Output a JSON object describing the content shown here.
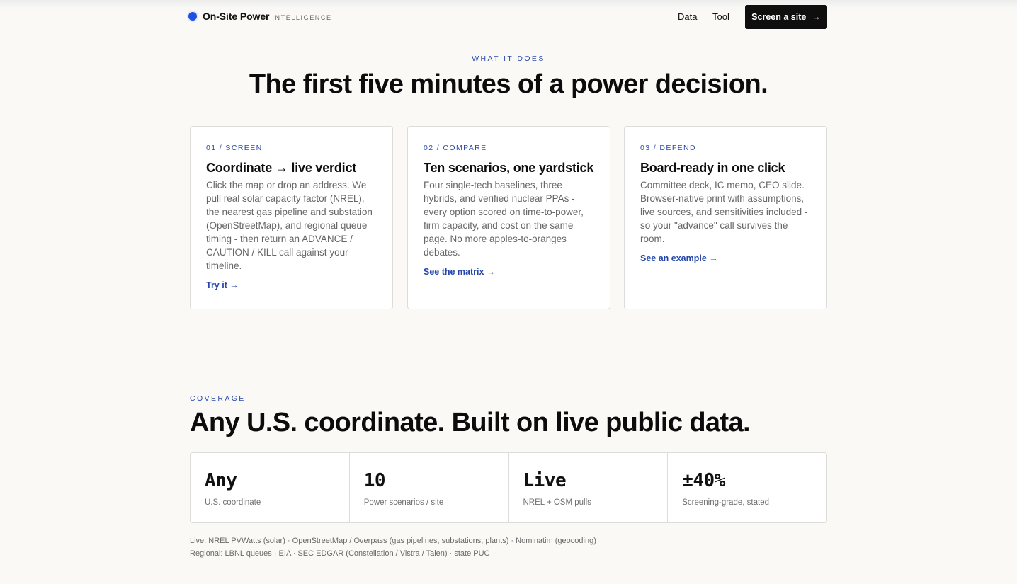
{
  "nav": {
    "brand_name": "On-Site Power",
    "brand_tag": "INTELLIGENCE",
    "links": [
      "Data",
      "Tool"
    ],
    "cta_label": "Screen a site",
    "cta_arrow": "→"
  },
  "what": {
    "eyebrow": "WHAT IT DOES",
    "heading": "The first five minutes of a power decision.",
    "cards": [
      {
        "step": "01 / SCREEN",
        "title": "Coordinate → live verdict",
        "body": "Click the map or drop an address. We pull real solar capacity factor (NREL), the nearest gas pipeline and substation (OpenStreetMap), and regional queue timing - then return an ADVANCE / CAUTION / KILL call against your timeline.",
        "link": "Try it →"
      },
      {
        "step": "02 / COMPARE",
        "title": "Ten scenarios, one yardstick",
        "body": "Four single-tech baselines, three hybrids, and verified nuclear PPAs - every option scored on time-to-power, firm capacity, and cost on the same page. No more apples-to-oranges debates.",
        "link": "See the matrix →"
      },
      {
        "step": "03 / DEFEND",
        "title": "Board-ready in one click",
        "body": "Committee deck, IC memo, CEO slide. Browser-native print with assumptions, live sources, and sensitivities included - so your \"advance\" call survives the room.",
        "link": "See an example →"
      }
    ]
  },
  "coverage": {
    "eyebrow": "COVERAGE",
    "heading": "Any U.S. coordinate. Built on live public data.",
    "stats": [
      {
        "value": "Any",
        "label": "U.S. coordinate"
      },
      {
        "value": "10",
        "label": "Power scenarios / site"
      },
      {
        "value": "Live",
        "label": "NREL + OSM pulls"
      },
      {
        "value": "±40%",
        "label": "Screening-grade, stated"
      }
    ],
    "sources_live": "Live: NREL PVWatts (solar) · OpenStreetMap / Overpass (gas pipelines, substations, plants) · Nominatim (geocoding)",
    "sources_regional": "Regional: LBNL queues · EIA · SEC EDGAR (Constellation / Vistra / Talen) · state PUC"
  },
  "colors": {
    "accent": "#2a4aa8",
    "brand_dot": "#1f4fe0",
    "cta_bg": "#0e0e0e",
    "page_bg": "#faf9f6"
  }
}
